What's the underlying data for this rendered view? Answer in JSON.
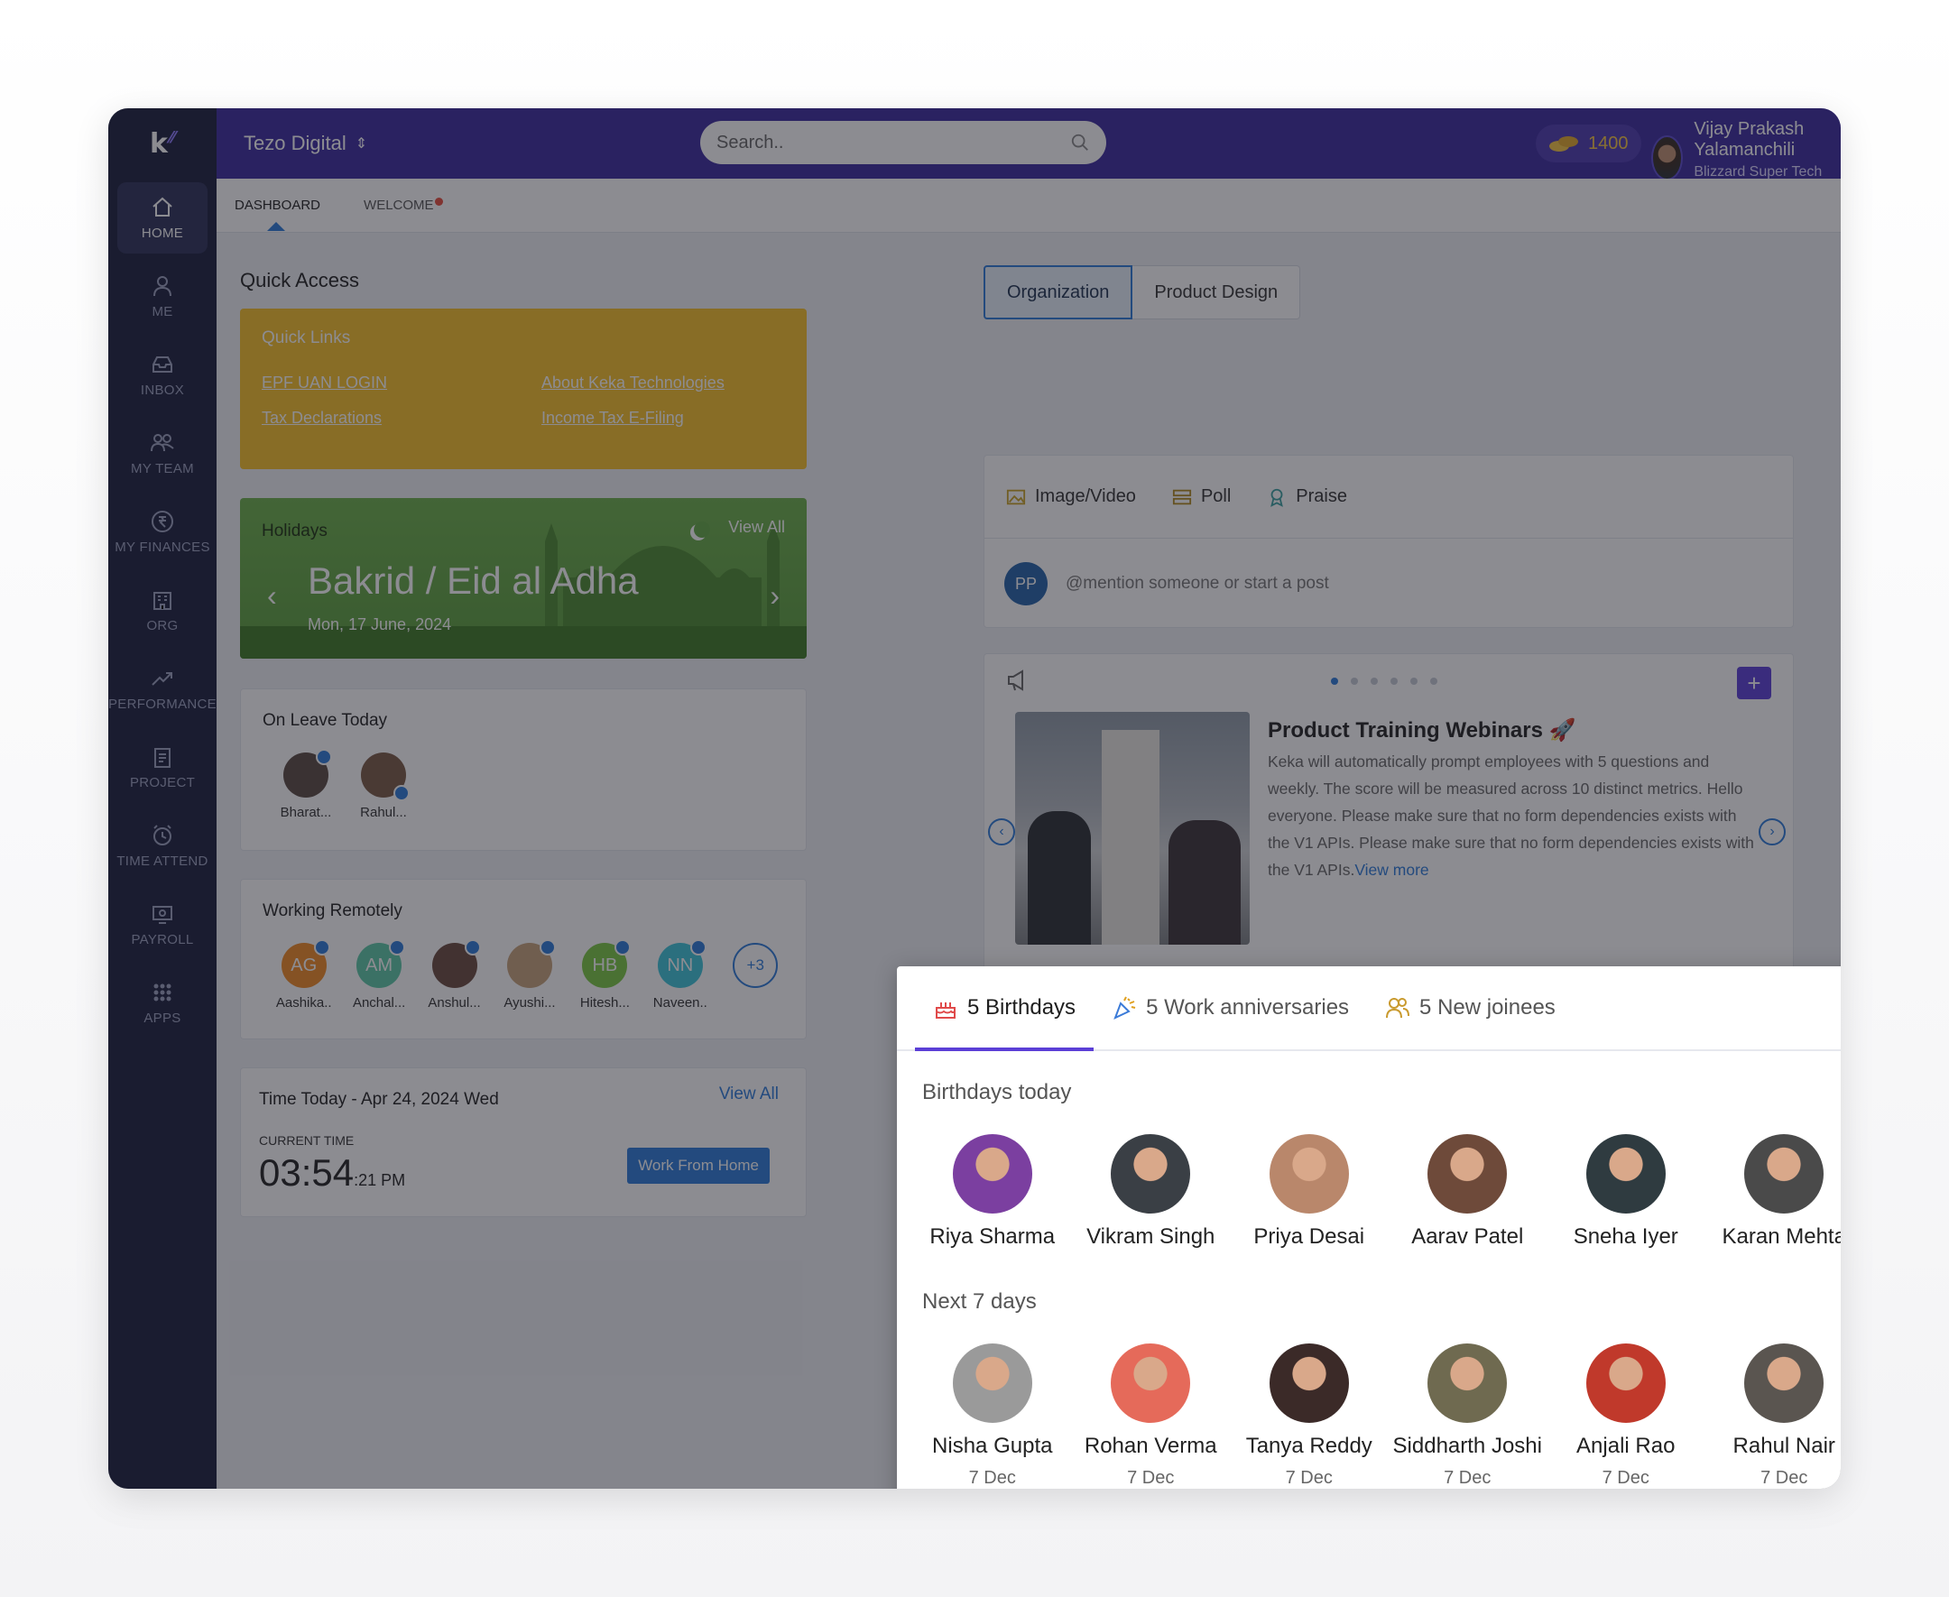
{
  "app": {
    "brand_letter": "k"
  },
  "sidebar": {
    "items": [
      {
        "label": "HOME",
        "icon": "home-icon"
      },
      {
        "label": "ME",
        "icon": "user-icon"
      },
      {
        "label": "INBOX",
        "icon": "inbox-icon"
      },
      {
        "label": "MY TEAM",
        "icon": "team-icon"
      },
      {
        "label": "MY FINANCES",
        "icon": "rupee-icon"
      },
      {
        "label": "ORG",
        "icon": "building-icon"
      },
      {
        "label": "PERFORMANCE",
        "icon": "trend-icon"
      },
      {
        "label": "PROJECT",
        "icon": "clipboard-icon"
      },
      {
        "label": "TIME ATTEND",
        "icon": "clock-icon"
      },
      {
        "label": "PAYROLL",
        "icon": "payroll-icon"
      },
      {
        "label": "APPS",
        "icon": "grid-icon"
      }
    ]
  },
  "topbar": {
    "org": "Tezo Digital",
    "search_placeholder": "Search..",
    "coins": "1400",
    "user_name": "Vijay Prakash Yalamanchili",
    "company": "Blizzard Super Tech Solutions"
  },
  "tabs": {
    "dashboard": "DASHBOARD",
    "welcome": "WELCOME"
  },
  "quick_access": {
    "title": "Quick Access",
    "links_title": "Quick Links",
    "links": [
      "EPF UAN LOGIN",
      "About Keka Technologies",
      "Tax Declarations",
      "Income Tax E-Filing"
    ]
  },
  "holidays": {
    "title": "Holidays",
    "view_all": "View All",
    "name": "Bakrid / Eid al Adha",
    "date": "Mon, 17 June, 2024"
  },
  "on_leave": {
    "title": "On Leave Today",
    "people": [
      "Bharat...",
      "Rahul..."
    ]
  },
  "remote": {
    "title": "Working Remotely",
    "people": [
      {
        "initials": "AG",
        "name": "Aashika..",
        "color": "#f08a24"
      },
      {
        "initials": "AM",
        "name": "Anchal...",
        "color": "#5cc9a7"
      },
      {
        "initials": "",
        "name": "Anshul...",
        "color": "#6b4b3e"
      },
      {
        "initials": "",
        "name": "Ayushi...",
        "color": "#c7a27a"
      },
      {
        "initials": "HB",
        "name": "Hitesh...",
        "color": "#7ac943"
      },
      {
        "initials": "NN",
        "name": "Naveen..",
        "color": "#3cc4d9"
      }
    ],
    "more": "+3"
  },
  "time_today": {
    "title": "Time Today - Apr 24, 2024 Wed",
    "view_all": "View All",
    "current_label": "CURRENT TIME",
    "time": "03:54",
    "secs": ":21 PM",
    "wfh": "Work From Home"
  },
  "feed": {
    "seg_org": "Organization",
    "seg_design": "Product Design",
    "actions": [
      "Image/Video",
      "Poll",
      "Praise"
    ],
    "avatar": "PP",
    "post_placeholder": "@mention someone or start a post",
    "announcement": {
      "title": "Product Training Webinars 🚀",
      "body": "Keka will automatically prompt employees with 5 questions and weekly. The score will be measured across 10 distinct metrics. Hello everyone. Please make sure that no form dependencies exists with the V1 APIs. Please make sure that no form dependencies exists with the V1 APIs.",
      "view_more": "View more"
    }
  },
  "popup": {
    "tabs": [
      "5 Birthdays",
      "5 Work anniversaries",
      "5 New joinees"
    ],
    "today_label": "Birthdays today",
    "today": [
      {
        "name": "Riya Sharma",
        "color": "#7b3fa0"
      },
      {
        "name": "Vikram Singh",
        "color": "#3a3f45"
      },
      {
        "name": "Priya Desai",
        "color": "#b9876b"
      },
      {
        "name": "Aarav Patel",
        "color": "#6e4a3a"
      },
      {
        "name": "Sneha Iyer",
        "color": "#2f3b40"
      },
      {
        "name": "Karan Mehta",
        "color": "#4a4a4a"
      }
    ],
    "next_label": "Next 7 days",
    "next": [
      {
        "name": "Nisha Gupta",
        "date": "7 Dec",
        "color": "#9a9a9a"
      },
      {
        "name": "Rohan Verma",
        "date": "7 Dec",
        "color": "#e56a5a"
      },
      {
        "name": "Tanya Reddy",
        "date": "7 Dec",
        "color": "#3b2a28"
      },
      {
        "name": "Siddharth Joshi",
        "date": "7 Dec",
        "color": "#6f6a50"
      },
      {
        "name": "Anjali Rao",
        "date": "7 Dec",
        "color": "#c0392b"
      },
      {
        "name": "Rahul Nair",
        "date": "7 Dec",
        "color": "#5a5550"
      }
    ]
  }
}
